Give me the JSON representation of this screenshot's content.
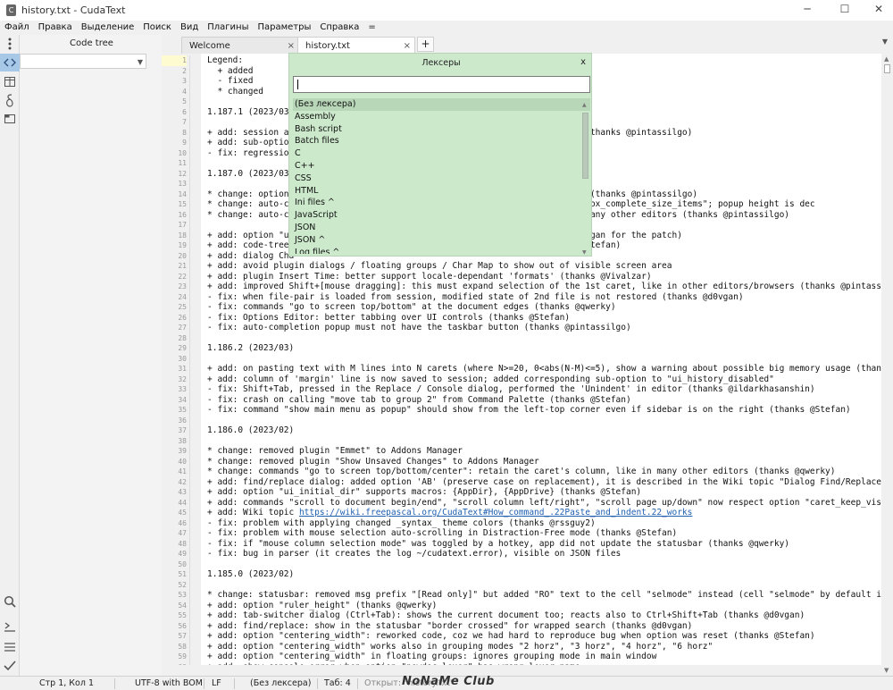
{
  "window": {
    "title": "history.txt - CudaText",
    "minimize": "─",
    "maximize": "☐",
    "close": "✕"
  },
  "menu": [
    "Файл",
    "Правка",
    "Выделение",
    "Поиск",
    "Вид",
    "Плагины",
    "Параметры",
    "Справка",
    "="
  ],
  "sidebar": {
    "icons": [
      "menu-icon",
      "code-tree-icon",
      "package-icon",
      "snippet-icon",
      "tabs-icon",
      "search-icon",
      "console-icon",
      "output-icon",
      "validate-icon"
    ]
  },
  "codetree": {
    "label": "Code tree",
    "combo_arrow": "▼"
  },
  "tabs": [
    {
      "label": "Welcome",
      "close": "×"
    },
    {
      "label": "history.txt",
      "close": "×"
    }
  ],
  "tab_add": "+",
  "tabs_menu": "▼",
  "lines": [
    {
      "n": "1",
      "t": "Legend:"
    },
    {
      "n": "2",
      "t": "  + added"
    },
    {
      "n": "3",
      "t": "  - fixed"
    },
    {
      "n": "4",
      "t": "  * changed"
    },
    {
      "n": "5",
      "t": ""
    },
    {
      "n": "6",
      "t": "1.187.1 (2023/03)"
    },
    {
      "n": "7",
      "t": ""
    },
    {
      "n": "8",
      "t": "+ add: session al                                          tory_disabled\" (thanks @pintassilgo)"
    },
    {
      "n": "9",
      "t": "+ add: sub-optior"
    },
    {
      "n": "10",
      "t": "- fix: regressior"
    },
    {
      "n": "11",
      "t": ""
    },
    {
      "n": "12",
      "t": "1.187.0 (2023/03)"
    },
    {
      "n": "13",
      "t": ""
    },
    {
      "n": "14",
      "t": "* change: option                                          ny other editors (thanks @pintassilgo)"
    },
    {
      "n": "15",
      "t": "* change: auto-cc                                         option: \"ui_listbox_complete_size_items\"; popup height is dec"
    },
    {
      "n": "16",
      "t": "* change: auto-cc                                         ection, like in many other editors (thanks @pintassilgo)"
    },
    {
      "n": "17",
      "t": ""
    },
    {
      "n": "18",
      "t": "+ add: option \"ui                                         gged (thanks @d0vgan for the patch)"
    },
    {
      "n": "19",
      "t": "+ add: code-tree                                          hsla() (thanks @Stefan)"
    },
    {
      "n": "20",
      "t": "+ add: dialog Cha"
    },
    {
      "n": "21",
      "t": "+ add: avoid plugin dialogs / floating groups / Char Map to show out of visible screen area"
    },
    {
      "n": "22",
      "t": "+ add: plugin Insert Time: better support locale-dependant 'formats' (thanks @Vivalzar)"
    },
    {
      "n": "23",
      "t": "+ add: improved Shift+[mouse dragging]: this must expand selection of the 1st caret, like in other editors/browsers (thanks @pintassilgo)"
    },
    {
      "n": "24",
      "t": "- fix: when file-pair is loaded from session, modified state of 2nd file is not restored (thanks @d0vgan)"
    },
    {
      "n": "25",
      "t": "- fix: commands \"go to screen top/bottom\" at the document edges (thanks @qwerky)"
    },
    {
      "n": "26",
      "t": "- fix: Options Editor: better tabbing over UI controls (thanks @Stefan)"
    },
    {
      "n": "27",
      "t": "- fix: auto-completion popup must not have the taskbar button (thanks @pintassilgo)"
    },
    {
      "n": "28",
      "t": ""
    },
    {
      "n": "29",
      "t": "1.186.2 (2023/03)"
    },
    {
      "n": "30",
      "t": ""
    },
    {
      "n": "31",
      "t": "+ add: on pasting text with M lines into N carets (where N>=20, 0<abs(N-M)<=5), show a warning about possible big memory usage (thanks @rssguy"
    },
    {
      "n": "32",
      "t": "+ add: column of 'margin' line is now saved to session; added corresponding sub-option to \"ui_history_disabled\""
    },
    {
      "n": "33",
      "t": "- fix: Shift+Tab, pressed in the Replace / Console dialog, performed the 'Unindent' in editor (thanks @ildarkhasanshin)"
    },
    {
      "n": "34",
      "t": "- fix: crash on calling \"move tab to group 2\" from Command Palette (thanks @Stefan)"
    },
    {
      "n": "35",
      "t": "- fix: command \"show main menu as popup\" should show from the left-top corner even if sidebar is on the right (thanks @Stefan)"
    },
    {
      "n": "36",
      "t": ""
    },
    {
      "n": "37",
      "t": "1.186.0 (2023/02)"
    },
    {
      "n": "38",
      "t": ""
    },
    {
      "n": "39",
      "t": "* change: removed plugin \"Emmet\" to Addons Manager"
    },
    {
      "n": "40",
      "t": "* change: removed plugin \"Show Unsaved Changes\" to Addons Manager"
    },
    {
      "n": "41",
      "t": "* change: commands \"go to screen top/bottom/center\": retain the caret's column, like in many other editors (thanks @qwerky)"
    },
    {
      "n": "42",
      "t": "+ add: find/replace dialog: added option 'AB' (preserve case on replacement), it is described in the Wiki topic \"Dialog Find/Replace\" (thanks"
    },
    {
      "n": "43",
      "t": "+ add: option \"ui_initial_dir\" supports macros: {AppDir}, {AppDrive} (thanks @Stefan)"
    },
    {
      "n": "44",
      "t": "+ add: commands \"scroll to document begin/end\", \"scroll column left/right\", \"scroll page up/down\" now respect option \"caret_keep_visible_on_sc"
    },
    {
      "n": "45",
      "t": "+ add: Wiki topic ",
      "link": "https://wiki.freepascal.org/CudaText#How_command_.22Paste_and_indent.22_works"
    },
    {
      "n": "46",
      "t": "- fix: problem with applying changed _syntax_ theme colors (thanks @rssguy2)"
    },
    {
      "n": "47",
      "t": "- fix: problem with mouse selection auto-scrolling in Distraction-Free mode (thanks @Stefan)"
    },
    {
      "n": "48",
      "t": "- fix: if \"mouse column selection mode\" was toggled by a hotkey, app did not update the statusbar (thanks @qwerky)"
    },
    {
      "n": "49",
      "t": "- fix: bug in parser (it creates the log ~/cudatext.error), visible on JSON files"
    },
    {
      "n": "50",
      "t": ""
    },
    {
      "n": "51",
      "t": "1.185.0 (2023/02)"
    },
    {
      "n": "52",
      "t": ""
    },
    {
      "n": "53",
      "t": "* change: statusbar: removed msg prefix \"[Read only]\" but added \"RO\" text to the cell \"selmode\" instead (cell \"selmode\" by default is located"
    },
    {
      "n": "54",
      "t": "+ add: option \"ruler_height\" (thanks @qwerky)"
    },
    {
      "n": "55",
      "t": "+ add: tab-switcher dialog (Ctrl+Tab): shows the current document too; reacts also to Ctrl+Shift+Tab (thanks @d0vgan)"
    },
    {
      "n": "56",
      "t": "+ add: find/replace: show in the statusbar \"border crossed\" for wrapped search (thanks @d0vgan)"
    },
    {
      "n": "57",
      "t": "+ add: option \"centering_width\": reworked code, coz we had hard to reproduce bug when option was reset (thanks @Stefan)"
    },
    {
      "n": "58",
      "t": "+ add: option \"centering_width\" works also in grouping modes \"2 horz\", \"3 horz\", \"4 horz\", \"6 horz\""
    },
    {
      "n": "59",
      "t": "+ add: option \"centering_width\" in floating groups: ignores grouping mode in main window"
    },
    {
      "n": "60",
      "t": "+ add: show console error when option \"newdoc_lexer\" has wrong lexer name"
    }
  ],
  "popup": {
    "title": "Лексеры",
    "close": "x",
    "query": "",
    "items": [
      "(Без лексера)",
      "Assembly",
      "Bash script",
      "Batch files",
      "C",
      "C++",
      "CSS",
      "HTML",
      "Ini files ^",
      "JavaScript",
      "JSON",
      "JSON ^",
      "Log files ^"
    ],
    "selected": 0
  },
  "status": {
    "position": "Стр 1, Кол 1",
    "encoding": "UTF-8 with BOM",
    "line_ends": "LF",
    "lexer": "(Без лексера)",
    "tab": "Таб: 4",
    "opened": "Открыт: \"history.txt\"",
    "watermark": "NoNaMe Club"
  },
  "colors": {
    "popup_bg": "#cce9cc",
    "link": "#1e5fb0",
    "accent": "#a8c8e8"
  }
}
